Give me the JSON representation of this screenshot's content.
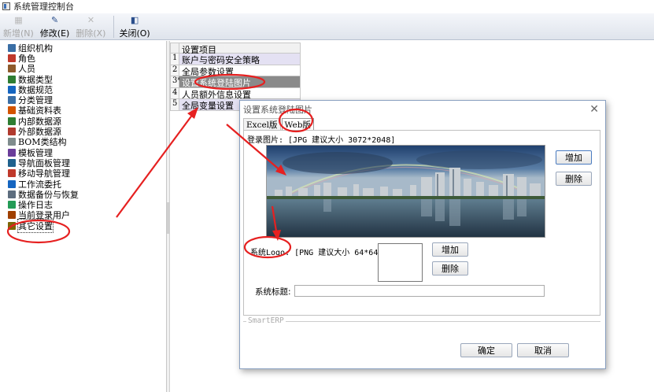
{
  "window": {
    "title": "系统管理控制台"
  },
  "toolbar": {
    "buttons": [
      {
        "label": "新增(N)",
        "icon": "new-icon",
        "enabled": false
      },
      {
        "label": "修改(E)",
        "icon": "edit-icon",
        "enabled": true
      },
      {
        "label": "删除(X)",
        "icon": "delete-icon",
        "enabled": false
      },
      {
        "label": "关闭(O)",
        "icon": "close-window-icon",
        "enabled": true
      }
    ]
  },
  "tree": {
    "items": [
      {
        "label": "组织机构",
        "color": "#3a6ea5"
      },
      {
        "label": "角色",
        "color": "#c0392b"
      },
      {
        "label": "人员",
        "color": "#8e5a2b"
      },
      {
        "label": "数据类型",
        "color": "#2e7d32"
      },
      {
        "label": "数据规范",
        "color": "#1565c0"
      },
      {
        "label": "分类管理",
        "color": "#3a6ea5"
      },
      {
        "label": "基础资料表",
        "color": "#d35400"
      },
      {
        "label": "内部数据源",
        "color": "#2e7d32"
      },
      {
        "label": "外部数据源",
        "color": "#b03a2e"
      },
      {
        "label": "BOM类结构",
        "color": "#7f8c8d"
      },
      {
        "label": "模板管理",
        "color": "#6a3d9a"
      },
      {
        "label": "导航面板管理",
        "color": "#1f618d"
      },
      {
        "label": "移动导航管理",
        "color": "#c0392b"
      },
      {
        "label": "工作流委托",
        "color": "#1565c0"
      },
      {
        "label": "数据备份与恢复",
        "color": "#5d6d7e"
      },
      {
        "label": "操作日志",
        "color": "#239b56"
      },
      {
        "label": "当前登录用户",
        "color": "#a04000"
      },
      {
        "label": "其它设置",
        "color": "#7d6608",
        "selected": true
      }
    ]
  },
  "grid": {
    "header": "设置项目",
    "rows": [
      {
        "num": "1",
        "label": "账户与密码安全策略"
      },
      {
        "num": "2",
        "label": "全局参数设置"
      },
      {
        "num": "3*",
        "label": "设置系统登陆图片"
      },
      {
        "num": "4",
        "label": "人员额外信息设置"
      },
      {
        "num": "5",
        "label": "全局变量设置"
      }
    ]
  },
  "dialog": {
    "title": "设置系统登陆图片",
    "tabs": [
      "Excel版",
      "Web版"
    ],
    "login_image_label": "登录图片: [JPG 建议大小 3072*2048]",
    "logo_label": "系统Logo: [PNG 建议大小 64*64]",
    "system_title_label": "系统标题:",
    "system_title_value": "",
    "add_label": "增加",
    "delete_label": "删除",
    "footer_legend": "SmartERP",
    "ok_label": "确定",
    "cancel_label": "取消"
  },
  "colors": {
    "annotation": "#e62020",
    "selected_row": "#8a8a8a",
    "alt_row": "#e4e1f3"
  }
}
